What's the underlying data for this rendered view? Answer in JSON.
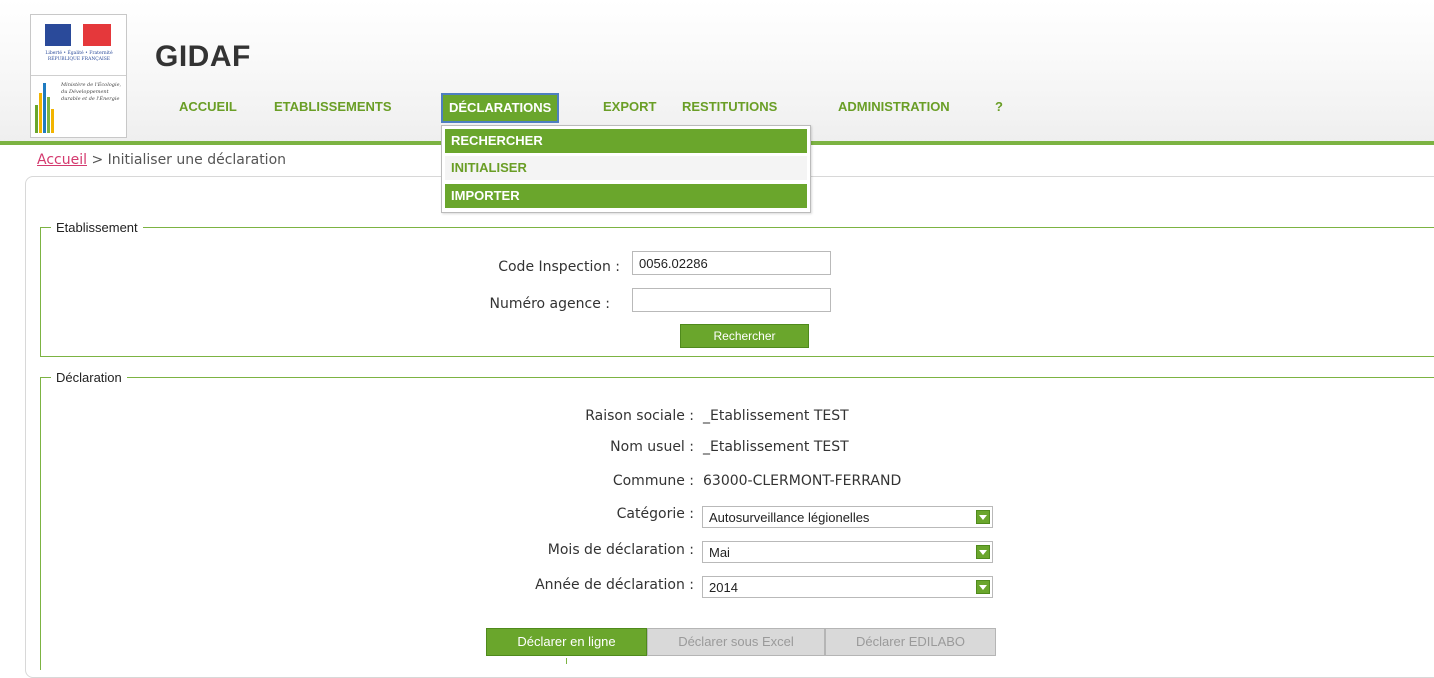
{
  "header": {
    "app_title": "GIDAF",
    "brand_color": "#6aa62c",
    "logo": {
      "marianne_text": "Liberté • Égalité • Fraternité RÉPUBLIQUE FRANÇAISE",
      "ministry_text": "Ministère de l'Écologie, du Développement durable et de l'Énergie"
    }
  },
  "nav": {
    "items": [
      {
        "label": "ACCUEIL"
      },
      {
        "label": "ETABLISSEMENTS"
      },
      {
        "label": "DÉCLARATIONS"
      },
      {
        "label": "EXPORT"
      },
      {
        "label": "RESTITUTIONS"
      },
      {
        "label": "ADMINISTRATION"
      },
      {
        "label": "?"
      }
    ],
    "active": "DÉCLARATIONS",
    "dropdown": [
      {
        "label": "RECHERCHER"
      },
      {
        "label": "INITIALISER"
      },
      {
        "label": "IMPORTER"
      }
    ]
  },
  "breadcrumb": {
    "home": "Accueil",
    "separator": ">",
    "current": "Initialiser une déclaration"
  },
  "etablissement": {
    "legend": "Etablissement",
    "code_label": "Code Inspection :",
    "code_value": "0056.02286",
    "agence_label": "Numéro agence :",
    "agence_value": "",
    "search_button": "Rechercher"
  },
  "declaration": {
    "legend": "Déclaration",
    "raison_label": "Raison sociale :",
    "raison_value": "_Etablissement TEST",
    "nom_label": "Nom usuel :",
    "nom_value": "_Etablissement TEST",
    "commune_label": "Commune :",
    "commune_value": "63000-CLERMONT-FERRAND",
    "categorie_label": "Catégorie :",
    "categorie_value": "Autosurveillance légionelles",
    "mois_label": "Mois de déclaration :",
    "mois_value": "Mai",
    "annee_label": "Année de déclaration :",
    "annee_value": "2014",
    "buttons": {
      "online": "Déclarer en ligne",
      "excel": "Déclarer sous Excel",
      "edilabo": "Déclarer EDILABO"
    }
  }
}
